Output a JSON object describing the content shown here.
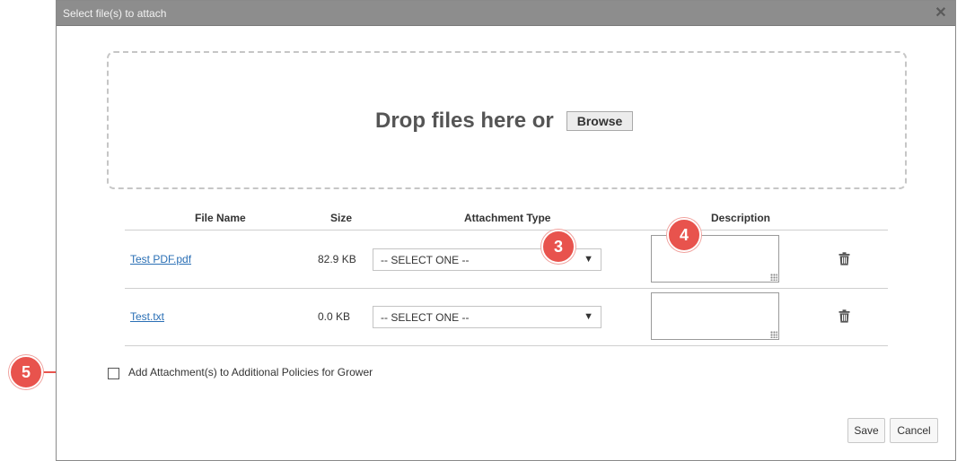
{
  "dialog": {
    "title": "Select file(s) to attach",
    "close_glyph": "✕"
  },
  "dropzone": {
    "text": "Drop files here or",
    "browse_label": "Browse"
  },
  "table": {
    "headers": {
      "file_name": "File Name",
      "size": "Size",
      "attachment_type": "Attachment Type",
      "description": "Description"
    },
    "rows": [
      {
        "file_name": "Test PDF.pdf",
        "size": "82.9 KB",
        "attachment_type": "-- SELECT ONE --",
        "description": ""
      },
      {
        "file_name": "Test.txt",
        "size": "0.0 KB",
        "attachment_type": "-- SELECT ONE --",
        "description": ""
      }
    ]
  },
  "checkbox": {
    "label": "Add Attachment(s) to Additional Policies for Grower",
    "checked": false
  },
  "buttons": {
    "save": "Save",
    "cancel": "Cancel"
  },
  "markers": [
    "3",
    "4",
    "5"
  ],
  "colors": {
    "titlebar": "#8d8d8d",
    "link": "#2a6fb5",
    "marker": "#e8534d"
  },
  "icons": {
    "close": "close-icon",
    "delete": "trash-icon",
    "dropdown": "caret-down-icon"
  }
}
